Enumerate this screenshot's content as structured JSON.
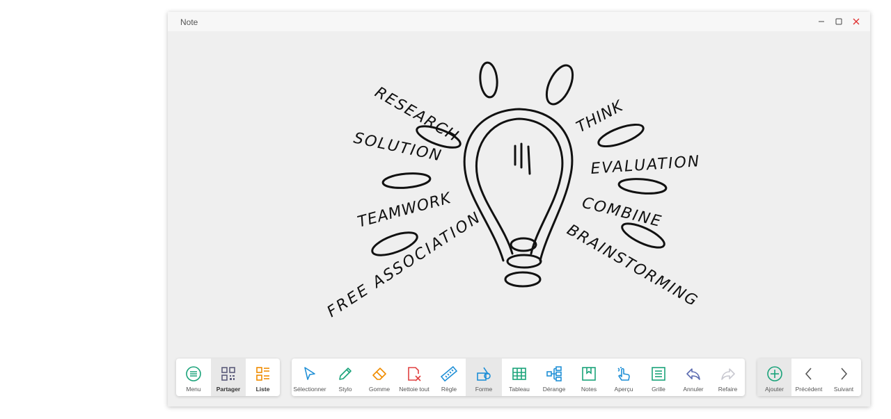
{
  "window": {
    "title": "Note"
  },
  "left_toolbar": [
    {
      "label": "Menu",
      "icon": "menu-icon",
      "color": "#1aa37a"
    },
    {
      "label": "Partager",
      "icon": "qr-share-icon",
      "color": "#5b5b7a"
    },
    {
      "label": "Liste",
      "icon": "list-icon",
      "color": "#f08c00"
    }
  ],
  "main_toolbar": [
    {
      "label": "Sélectionner",
      "icon": "select-cursor-icon",
      "color": "#1f8fd6"
    },
    {
      "label": "Stylo",
      "icon": "pen-icon",
      "color": "#1aa37a"
    },
    {
      "label": "Gomme",
      "icon": "eraser-icon",
      "color": "#f08c00"
    },
    {
      "label": "Nettoie tout",
      "icon": "clear-all-icon",
      "color": "#e04040"
    },
    {
      "label": "Règle",
      "icon": "ruler-icon",
      "color": "#1f8fd6"
    },
    {
      "label": "Forme",
      "icon": "shape-icon",
      "color": "#1f8fd6"
    },
    {
      "label": "Tableau",
      "icon": "table-icon",
      "color": "#1aa37a"
    },
    {
      "label": "Dérange",
      "icon": "mindmap-icon",
      "color": "#1f8fd6"
    },
    {
      "label": "Notes",
      "icon": "notes-icon",
      "color": "#1aa37a"
    },
    {
      "label": "Aperçu",
      "icon": "touch-preview-icon",
      "color": "#1f8fd6"
    },
    {
      "label": "Grille",
      "icon": "grid-icon",
      "color": "#1aa37a"
    },
    {
      "label": "Annuler",
      "icon": "undo-icon",
      "color": "#5b6bb0"
    },
    {
      "label": "Refaire",
      "icon": "redo-icon",
      "color": "#c8c8d0"
    }
  ],
  "right_toolbar": [
    {
      "label": "Ajouter",
      "icon": "add-page-icon",
      "color": "#1aa37a"
    },
    {
      "label": "Précédent",
      "icon": "chevron-left-icon",
      "color": "#555555"
    },
    {
      "label": "Suivant",
      "icon": "chevron-right-icon",
      "color": "#555555"
    }
  ],
  "drawing": {
    "words": [
      "RESEARCH",
      "SOLUTION",
      "TEAMWORK",
      "FREE ASSOCIATION",
      "THINK",
      "EVALUATION",
      "COMBINE",
      "BRAINSTORMING"
    ],
    "stroke_color": "#111111"
  }
}
